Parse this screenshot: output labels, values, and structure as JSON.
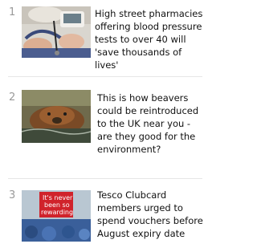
{
  "articles": [
    {
      "rank": "1",
      "headline": "High street pharmacies offering blood pressure tests to over 40 will 'save thousands of lives'"
    },
    {
      "rank": "2",
      "headline": "This is how beavers could be reintroduced to the UK near you - are they good for the environment?"
    },
    {
      "rank": "3",
      "headline": "Tesco Clubcard members urged to spend vouchers before August expiry date",
      "thumbnail_sign": [
        "It's never",
        "been so",
        "rewarding"
      ]
    }
  ]
}
